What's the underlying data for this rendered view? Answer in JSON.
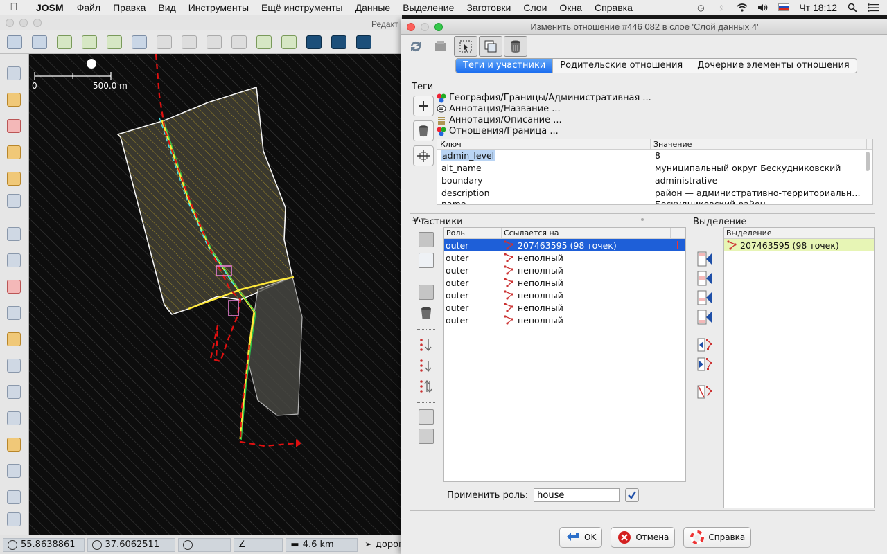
{
  "menubar": {
    "app": "JOSM",
    "items": [
      "Файл",
      "Правка",
      "Вид",
      "Инструменты",
      "Ещё инструменты",
      "Данные",
      "Выделение",
      "Заготовки",
      "Слои",
      "Окна",
      "Справка"
    ],
    "clock": "Чт 18:12"
  },
  "main_window": {
    "title_fragment": "Редакт",
    "scale": {
      "zero": "0",
      "distance": "500.0 m"
    },
    "status": {
      "lat": "55.8638861",
      "lon": "37.6062511",
      "distance": "4.6 km",
      "hover": "дорог"
    }
  },
  "dialog": {
    "title": "Изменить отношение #446 082 в слое 'Слой данных 4'",
    "tabs": [
      "Теги и участники",
      "Родительские отношения",
      "Дочерние элементы отношения"
    ],
    "tags_label": "Теги",
    "presets": [
      {
        "text": "География/Границы/Административная ...",
        "icon": "boundary-preset-icon"
      },
      {
        "text": "Аннотация/Название ...",
        "icon": "name-preset-icon"
      },
      {
        "text": "Аннотация/Описание ...",
        "icon": "description-preset-icon"
      },
      {
        "text": "Отношения/Граница ...",
        "icon": "boundary-relation-preset-icon"
      }
    ],
    "tag_table": {
      "headers": [
        "Ключ",
        "Значение"
      ],
      "rows": [
        {
          "key": "admin_level",
          "value": "8"
        },
        {
          "key": "alt_name",
          "value": "муниципальный округ Бескудниковский"
        },
        {
          "key": "boundary",
          "value": "administrative"
        },
        {
          "key": "description",
          "value": "район — административно-территориальная..."
        },
        {
          "key": "name",
          "value": "Бескудниковский район"
        }
      ]
    },
    "members_label": "Участники",
    "members_table": {
      "headers": [
        "Роль",
        "Ссылается на"
      ],
      "rows": [
        {
          "role": "outer",
          "ref": "207463595 (98 точек)"
        },
        {
          "role": "outer",
          "ref": "неполный"
        },
        {
          "role": "outer",
          "ref": "неполный"
        },
        {
          "role": "outer",
          "ref": "неполный"
        },
        {
          "role": "outer",
          "ref": "неполный"
        },
        {
          "role": "outer",
          "ref": "неполный"
        },
        {
          "role": "outer",
          "ref": "неполный"
        }
      ]
    },
    "selection_label": "Выделение",
    "selection_table": {
      "header": "Выделение",
      "rows": [
        "207463595 (98 точек)"
      ]
    },
    "apply_role": {
      "label": "Применить роль:",
      "value": "house"
    },
    "buttons": {
      "ok": "OK",
      "cancel": "Отмена",
      "help": "Справка"
    }
  }
}
